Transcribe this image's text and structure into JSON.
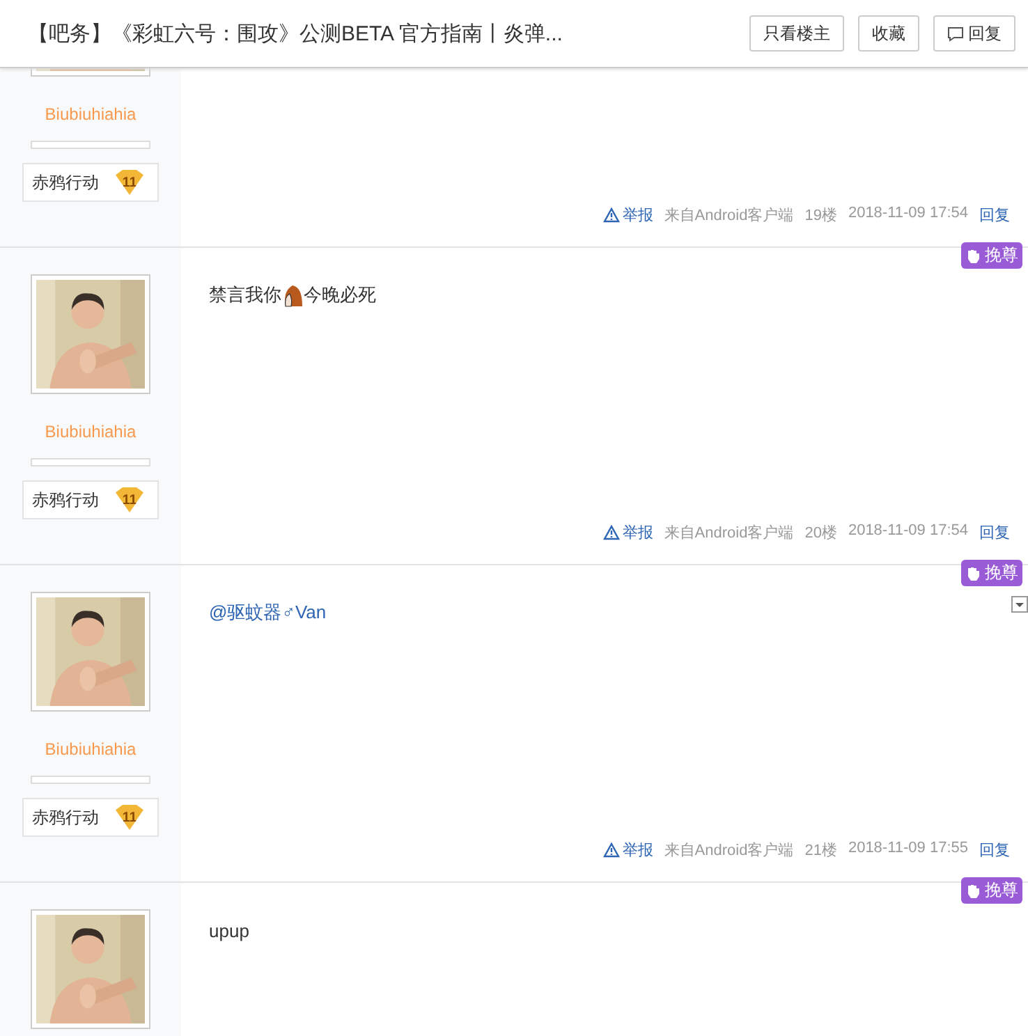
{
  "header": {
    "title": "【吧务】《彩虹六号：围攻》公测BETA 官方指南丨炎弹...",
    "buttons": [
      {
        "label": "只看楼主",
        "kind": "text"
      },
      {
        "label": "收藏",
        "kind": "text"
      },
      {
        "label": "回复",
        "kind": "reply"
      }
    ]
  },
  "posts": [
    {
      "avatar": {
        "kind": "picture"
      },
      "username": "Biubiuhiahia",
      "forum_tag": "赤鸦行动",
      "level": "11",
      "footer": {
        "report": "举报",
        "source": "来自Android客户端",
        "floor": "19楼",
        "time": "2018-11-09 17:54",
        "reply": "回复"
      }
    },
    {
      "avatar": {
        "kind": "picture"
      },
      "badge": "挽尊",
      "username": "Biubiuhiahia",
      "forum_tag": "赤鸦行动",
      "level": "11",
      "content": [
        {
          "kind": "text",
          "text": "禁言我你"
        },
        {
          "kind": "emoticon"
        },
        {
          "kind": "text",
          "text": "今晚必死"
        }
      ],
      "dropdown": false,
      "footer": {
        "report": "举报",
        "source": "来自Android客户端",
        "floor": "20楼",
        "time": "2018-11-09 17:54",
        "reply": "回复"
      }
    },
    {
      "avatar": {
        "kind": "picture"
      },
      "badge": "挽尊",
      "username": "Biubiuhiahia",
      "forum_tag": "赤鸦行动",
      "level": "11",
      "content": [
        {
          "kind": "mention",
          "text": "@驱蚊器♂Van"
        }
      ],
      "dropdown": true,
      "footer": {
        "report": "举报",
        "source": "来自Android客户端",
        "floor": "21楼",
        "time": "2018-11-09 17:55",
        "reply": "回复"
      }
    },
    {
      "avatar": {
        "kind": "picture"
      },
      "badge": "挽尊",
      "content": [
        {
          "kind": "text",
          "text": "upup"
        }
      ],
      "dropdown": false
    }
  ]
}
